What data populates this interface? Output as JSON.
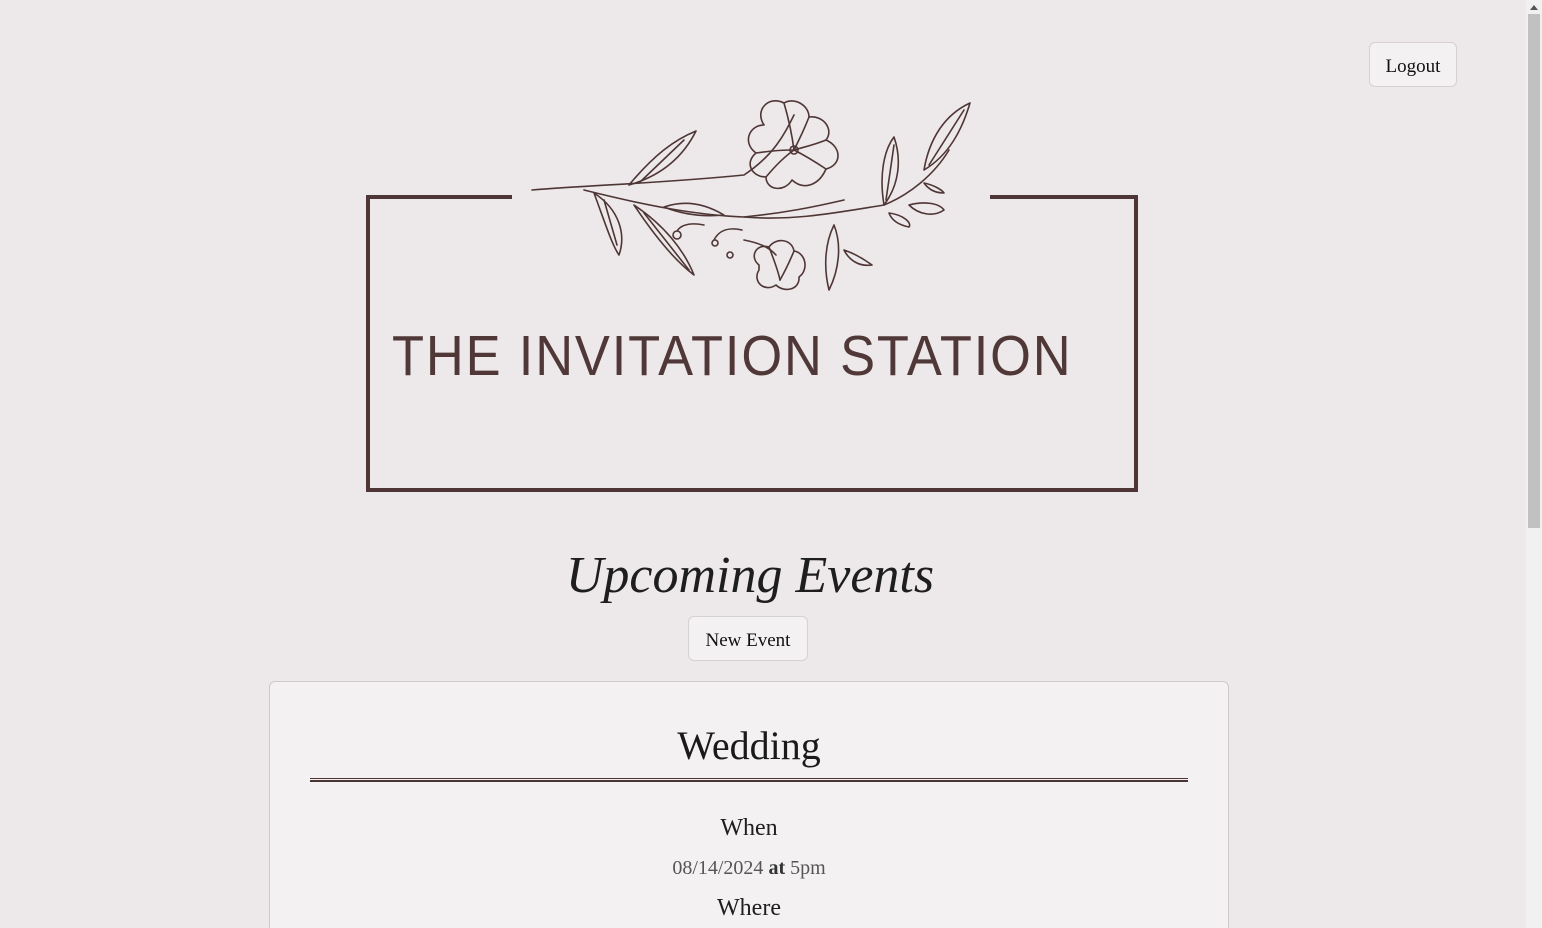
{
  "header": {
    "logout_label": "Logout"
  },
  "logo": {
    "title": "THE INVITATION STATION",
    "color": "#4f3636",
    "icon": "floral-branch-icon"
  },
  "main": {
    "section_title": "Upcoming Events",
    "new_event_label": "New Event"
  },
  "events": [
    {
      "name": "Wedding",
      "when_label": "When",
      "date": "08/14/2024",
      "at_label": "at",
      "time": "5pm",
      "where_label": "Where"
    }
  ],
  "colors": {
    "background": "#ede8e9",
    "card": "#f3f1f2",
    "brand": "#4f3636"
  }
}
